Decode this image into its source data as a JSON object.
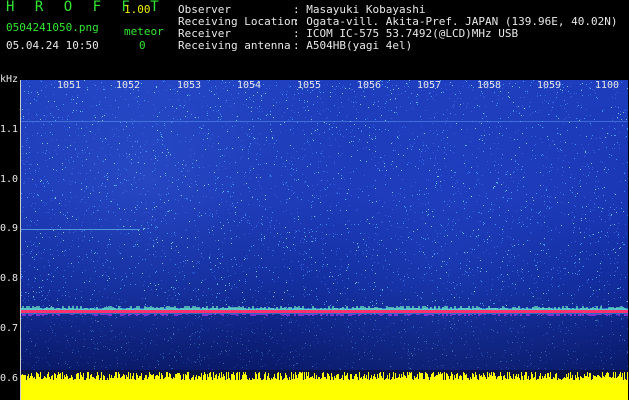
{
  "header": {
    "app_title": "H R O F F T",
    "version": "1.00",
    "filename": "0504241050.png",
    "datetime": "05.04.24 10:50",
    "meteor_label": "meteor",
    "meteor_count": "0"
  },
  "info": [
    {
      "key": "Observer",
      "value": ": Masayuki Kobayashi"
    },
    {
      "key": "Receiving Location",
      "value": ": Ogata-vill. Akita-Pref. JAPAN (139.96E, 40.02N)"
    },
    {
      "key": "Receiver",
      "value": ": ICOM IC-575 53.7492(@LCD)MHz USB"
    },
    {
      "key": "Receiving antenna",
      "value": ": A504HB(yagi 4el)"
    }
  ],
  "axes": {
    "y_unit": "kHz",
    "y_ticks": [
      "1.1",
      "1.0",
      "0.9",
      "0.8",
      "0.7",
      "0.6"
    ],
    "x_ticks": [
      "1051",
      "1052",
      "1053",
      "1054",
      "1055",
      "1056",
      "1057",
      "1058",
      "1059",
      "1100"
    ]
  },
  "colors": {
    "background": "#000000",
    "text_green": "#32e632",
    "text_yellow": "#f0f000",
    "spectrum_blue": "#1a36b4",
    "signal_line": "#ff3070",
    "noise_level": "#ffff00"
  }
}
